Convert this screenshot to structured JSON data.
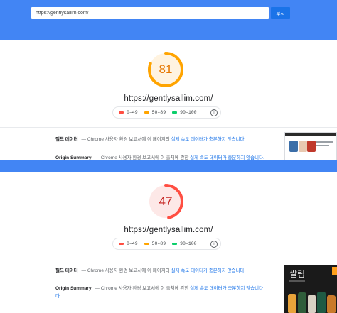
{
  "search": {
    "url_value": "https://gentlysallim.com/",
    "analyze_label": "분석"
  },
  "reports": [
    {
      "score": "81",
      "score_value": 81,
      "score_color": "#ffa400",
      "score_bg": "#fff3e0",
      "url": "https://gentlysallim.com/",
      "field_data": {
        "label": "필드 데이터",
        "dash": "—",
        "text": "Chrome 사용자 환경 보고서에 이 페이지의",
        "link": "실제 속도 데이터가 충분하지 않습니다."
      },
      "origin_summary": {
        "label": "Origin Summary",
        "dash": "—",
        "text": "Chrome 사용자 환경 보고서에 이 출처에 관한",
        "link": "실제 속도 데이터가 충분하지 않습니다."
      }
    },
    {
      "score": "47",
      "score_value": 47,
      "score_color": "#ff4e42",
      "score_bg": "#fde8e7",
      "url": "https://gentlysallim.com/",
      "field_data": {
        "label": "필드 데이터",
        "dash": "—",
        "text": "Chrome 사용자 환경 보고서에 이 페이지의",
        "link": "실제 속도 데이터가 충분하지 않습니다."
      },
      "origin_summary": {
        "label": "Origin Summary",
        "dash": "—",
        "text": "Chrome 사용자 환경 보고서에 이 출처에 관한",
        "link": "실제 속도 데이터가 충분하지 않습니다",
        "link_wrap": "다"
      }
    }
  ],
  "legend": {
    "poor": "0–49",
    "needs_improvement": "50–89",
    "good": "90–100",
    "info_icon": "info-icon"
  },
  "thumbnail": {
    "logo_text": "쌀림"
  },
  "colors": {
    "brand_blue": "#4285f4",
    "button_blue": "#1a73e8",
    "poor": "#ff4e42",
    "average": "#ffa400",
    "good": "#0cce6b"
  }
}
